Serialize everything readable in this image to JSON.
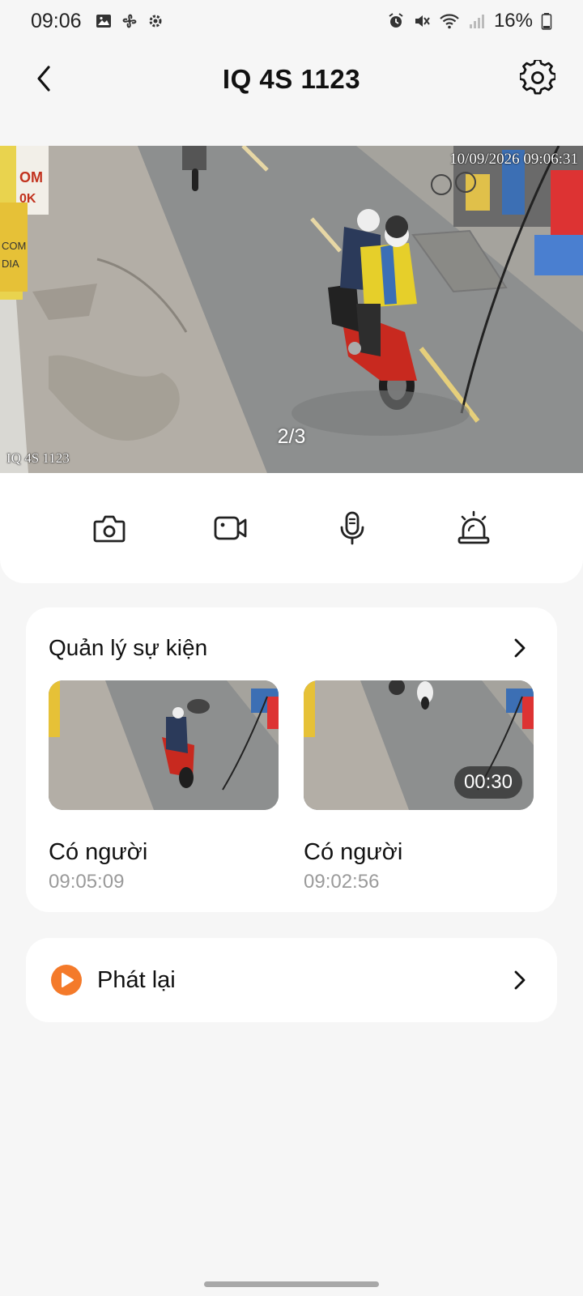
{
  "status_bar": {
    "time": "09:06",
    "battery": "16%"
  },
  "header": {
    "title": "IQ 4S 1123"
  },
  "video": {
    "osd_timestamp": "10/09/2026 09:06:31",
    "osd_camera_name": "IQ 4S 1123",
    "pager": "2/3"
  },
  "controls": [
    {
      "icon": "camera-snapshot-icon"
    },
    {
      "icon": "video-record-icon"
    },
    {
      "icon": "microphone-icon"
    },
    {
      "icon": "alarm-siren-icon"
    }
  ],
  "events": {
    "title": "Quản lý sự kiện",
    "items": [
      {
        "label": "Có người",
        "time": "09:05:09",
        "duration": ""
      },
      {
        "label": "Có người",
        "time": "09:02:56",
        "duration": "00:30"
      }
    ]
  },
  "playback": {
    "label": "Phát lại",
    "accent": "#f47a2a"
  }
}
